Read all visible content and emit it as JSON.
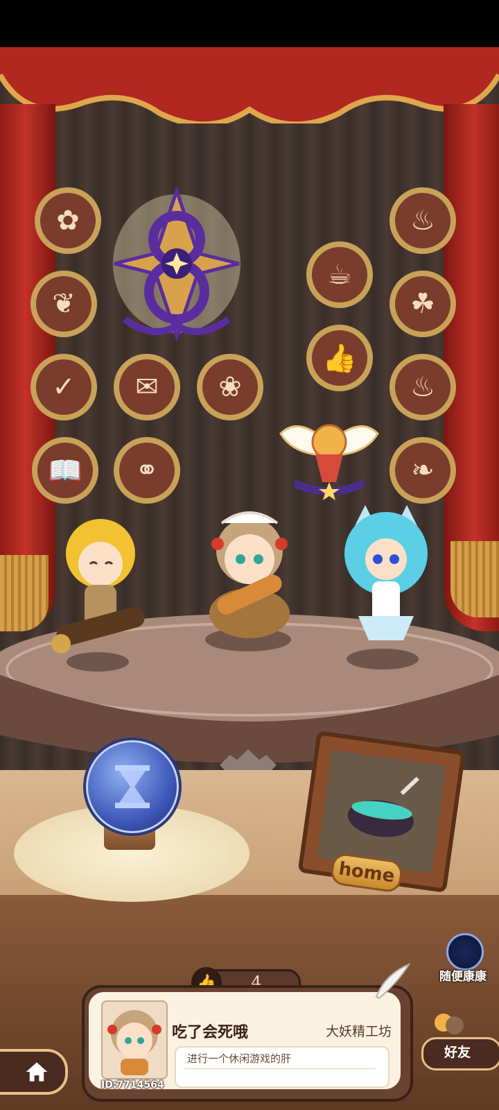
{
  "game": {
    "like_count": "4",
    "home_sign": "home",
    "random_visit_label": "随便康康",
    "friends_label": "好友"
  },
  "profile": {
    "name": "吃了会死哦",
    "guild": "大妖精工坊",
    "signature": "进行一个休闲游戏的肝",
    "id_text": "ID:7714564"
  },
  "badges": [
    {
      "icon": "fairy-silhouette-icon"
    },
    {
      "icon": "cauldron-icon"
    },
    {
      "icon": "bouquet-icon"
    },
    {
      "icon": "mug-icon"
    },
    {
      "icon": "hand-plant-icon"
    },
    {
      "icon": "scroll-check-icon"
    },
    {
      "icon": "scroll-ribbon-icon"
    },
    {
      "icon": "sprout-icon"
    },
    {
      "icon": "thumb-up-icon"
    },
    {
      "icon": "cauldron-stir-icon"
    },
    {
      "icon": "book-icon"
    },
    {
      "icon": "pair-silhouette-icon"
    },
    {
      "icon": "wind-leaf-icon"
    }
  ],
  "colors": {
    "curtain": "#c3322a",
    "badge_gold": "#c9a25a",
    "badge_inner": "#7a3c2c",
    "featured_purple": "#5a2d9e",
    "orb_blue": "#3e57b8"
  }
}
